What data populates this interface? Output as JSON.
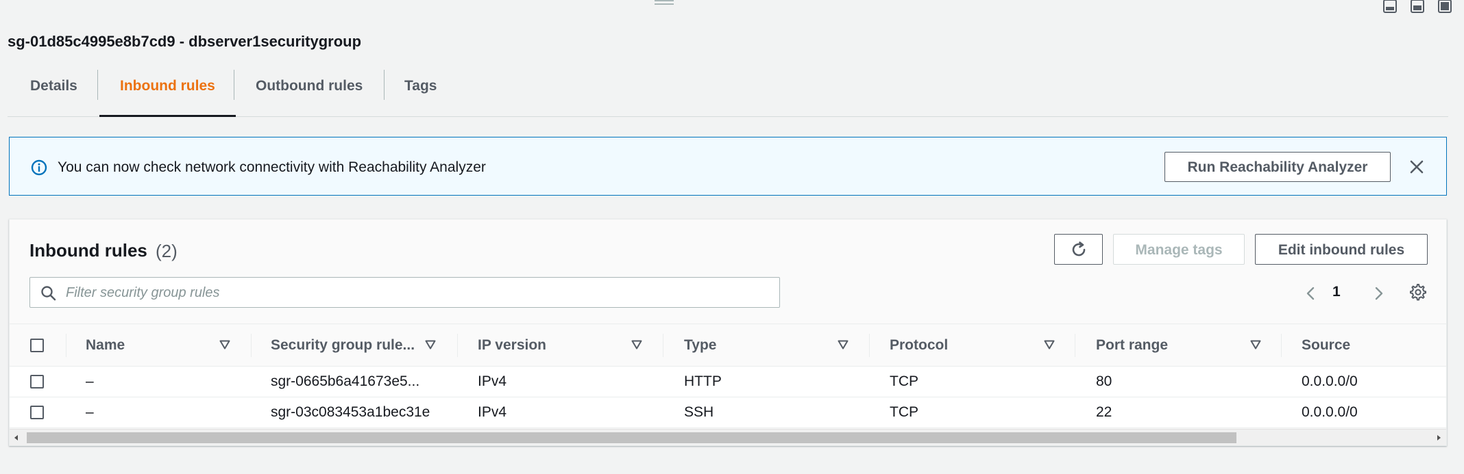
{
  "security_group": {
    "title": "sg-01d85c4995e8b7cd9 - dbserver1securitygroup"
  },
  "tabs": [
    {
      "label": "Details",
      "active": false
    },
    {
      "label": "Inbound rules",
      "active": true
    },
    {
      "label": "Outbound rules",
      "active": false
    },
    {
      "label": "Tags",
      "active": false
    }
  ],
  "banner": {
    "icon": "info-icon",
    "text": "You can now check network connectivity with Reachability Analyzer",
    "button_label": "Run Reachability Analyzer",
    "close_icon": "close-icon"
  },
  "rules_table": {
    "title": "Inbound rules",
    "count": "(2)",
    "refresh_icon": "refresh-icon",
    "manage_tags_label": "Manage tags",
    "edit_label": "Edit inbound rules",
    "search_placeholder": "Filter security group rules",
    "search_value": "",
    "current_page": "1",
    "columns": [
      "Name",
      "Security group rule...",
      "IP version",
      "Type",
      "Protocol",
      "Port range",
      "Source"
    ],
    "rows": [
      {
        "name": "–",
        "rule_id": "sgr-0665b6a41673e5...",
        "ip_version": "IPv4",
        "type": "HTTP",
        "protocol": "TCP",
        "port_range": "80",
        "source": "0.0.0.0/0"
      },
      {
        "name": "–",
        "rule_id": "sgr-03c083453a1bec31e",
        "ip_version": "IPv4",
        "type": "SSH",
        "protocol": "TCP",
        "port_range": "22",
        "source": "0.0.0.0/0"
      }
    ]
  },
  "colors": {
    "accent_orange": "#ec7211",
    "info_blue": "#0073bb",
    "banner_bg": "#f1faff",
    "text_dark": "#16191f",
    "text_muted": "#545b64"
  }
}
